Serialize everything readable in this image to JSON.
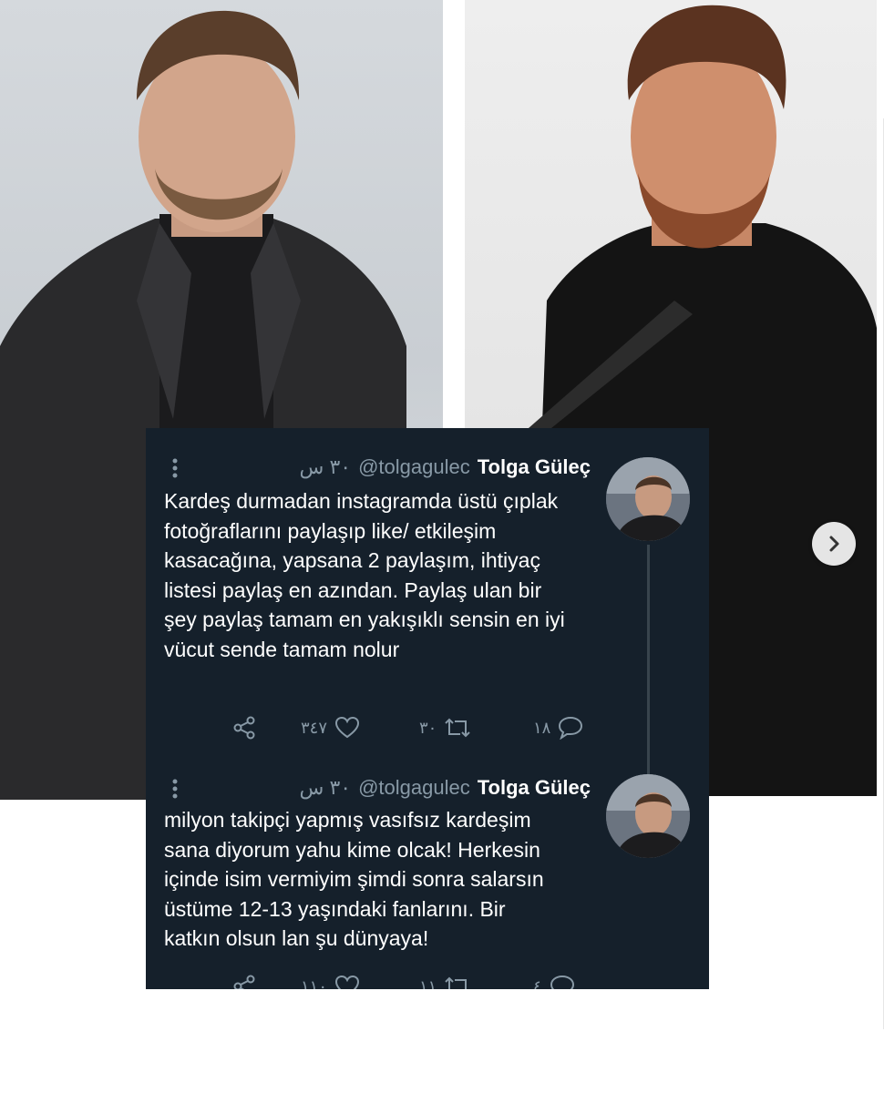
{
  "carousel": {
    "next_icon": "chevron-right-icon"
  },
  "tweets": [
    {
      "name": "Tolga Güleç",
      "handle": "@tolgagulec",
      "time": "٣٠ س",
      "text": "Kardeş durmadan instagramda üstü çıplak fotoğraflarını paylaşıp like/ etkileşim kasacağına, yapsana 2 paylaşım, ihtiyaç listesi paylaş en azından. Paylaş ulan bir şey paylaş tamam en yakışıklı sensin en iyi vücut sende tamam nolur",
      "likes": "٣٤٧",
      "retweets": "٣٠",
      "replies": "١٨"
    },
    {
      "name": "Tolga Güleç",
      "handle": "@tolgagulec",
      "time": "٣٠ س",
      "text": "milyon takipçi yapmış vasıfsız kardeşim sana diyorum yahu kime olcak! Herkesin içinde isim vermiyim şimdi sonra salarsın üstüme 12-13 yaşındaki fanlarını. Bir katkın olsun lan şu dünyaya!",
      "likes": "١١٠",
      "retweets": "١١",
      "replies": "٤"
    }
  ],
  "colors": {
    "card_background": "#15202b",
    "text_primary": "#ffffff",
    "text_secondary": "#8899a6"
  }
}
